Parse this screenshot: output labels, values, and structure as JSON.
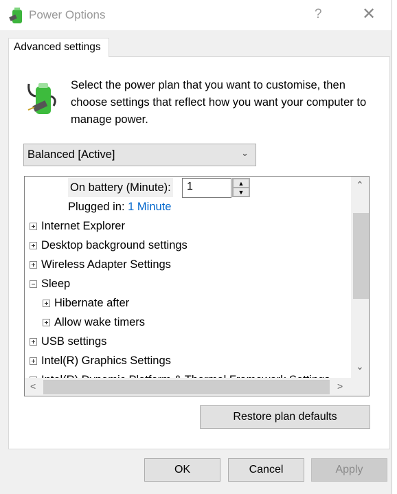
{
  "window": {
    "title": "Power Options",
    "help_label": "?",
    "close_label": "✕",
    "icon": "power-battery-icon"
  },
  "tab": {
    "label": "Advanced settings"
  },
  "description": "Select the power plan that you want to customise, then choose settings that reflect how you want your computer to manage power.",
  "plan_select": {
    "value": "Balanced [Active]"
  },
  "tree": {
    "on_battery_label": "On battery (Minute):",
    "on_battery_value": "1",
    "plugged_in_label": "Plugged in:",
    "plugged_in_value": "1 Minute",
    "items": [
      {
        "label": "Internet Explorer",
        "state": "collapsed"
      },
      {
        "label": "Desktop background settings",
        "state": "collapsed"
      },
      {
        "label": "Wireless Adapter Settings",
        "state": "collapsed"
      },
      {
        "label": "Sleep",
        "state": "expanded"
      },
      {
        "label": "Hibernate after",
        "state": "collapsed"
      },
      {
        "label": "Allow wake timers",
        "state": "collapsed"
      },
      {
        "label": "USB settings",
        "state": "collapsed"
      },
      {
        "label": "Intel(R) Graphics Settings",
        "state": "collapsed"
      },
      {
        "label": "Intel(R) Dynamic Platform & Thermal Framework Settings",
        "state": "collapsed"
      }
    ]
  },
  "buttons": {
    "restore": "Restore plan defaults",
    "ok": "OK",
    "cancel": "Cancel",
    "apply": "Apply"
  },
  "colors": {
    "link": "#0066cc"
  }
}
